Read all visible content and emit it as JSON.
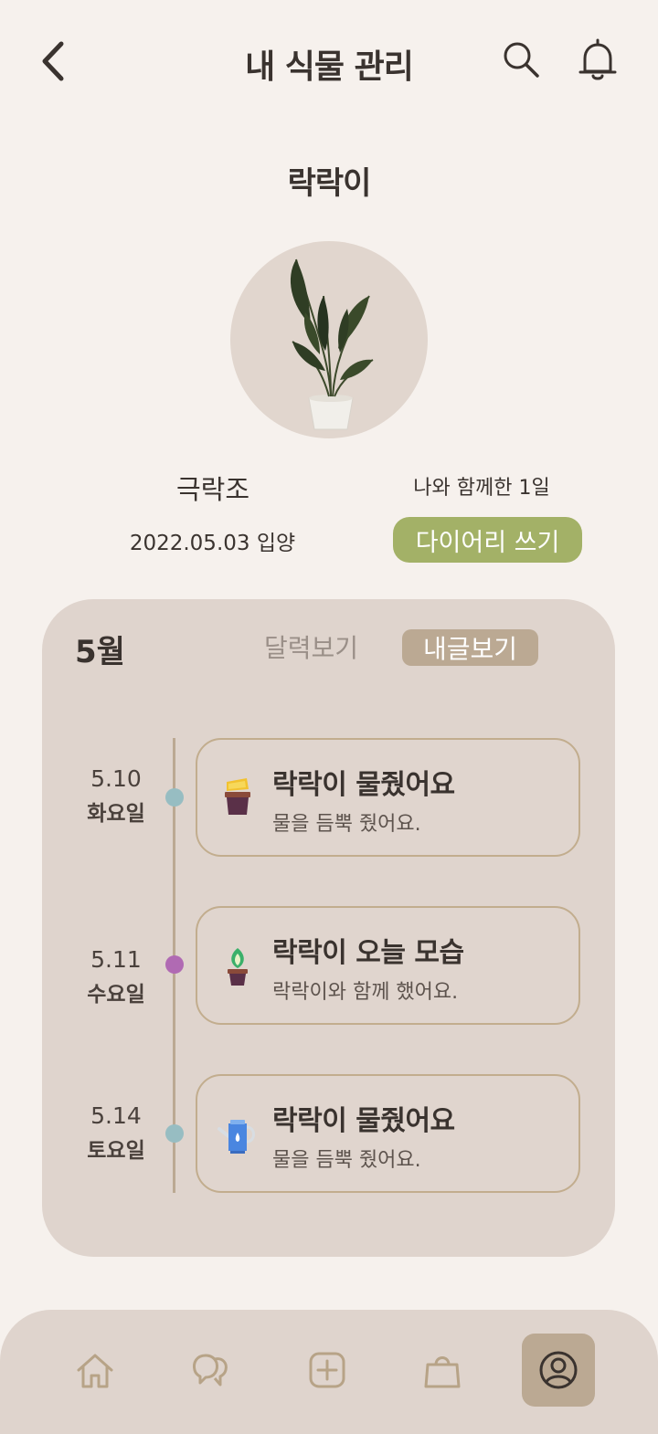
{
  "header": {
    "title": "내 식물 관리",
    "back_icon": "chevron-left-icon",
    "search_icon": "search-icon",
    "bell_icon": "bell-icon"
  },
  "plant": {
    "name": "락락이",
    "species": "극락조",
    "adopt_date": "2022.05.03 입양",
    "together": "나와 함께한 1일",
    "diary_button": "다이어리 쓰기"
  },
  "timeline_card": {
    "month": "5월",
    "tab_calendar": "달력보기",
    "tab_my_posts": "내글보기",
    "entries": [
      {
        "date": "5.10",
        "weekday": "화요일",
        "title": "락락이 물줬어요",
        "desc": "물을 듬뿍 줬어요.",
        "dot_color": "#97bdc2",
        "icon": "flower-pot-icon"
      },
      {
        "date": "5.11",
        "weekday": "수요일",
        "title": "락락이 오늘 모습",
        "desc": "락락이와 함께 했어요.",
        "dot_color": "#b06ab3",
        "icon": "sprout-icon"
      },
      {
        "date": "5.14",
        "weekday": "토요일",
        "title": "락락이 물줬어요",
        "desc": "물을 듬뿍 줬어요.",
        "dot_color": "#97bdc2",
        "icon": "watering-can-icon"
      }
    ]
  },
  "bottom_nav": {
    "items": [
      {
        "icon": "home-icon",
        "active": false
      },
      {
        "icon": "chat-icon",
        "active": false
      },
      {
        "icon": "add-icon",
        "active": false
      },
      {
        "icon": "shopping-bag-icon",
        "active": false
      },
      {
        "icon": "profile-icon",
        "active": true
      }
    ]
  },
  "colors": {
    "background": "#f6f1ed",
    "card": "#dfd4cd",
    "accent_green": "#a3b167",
    "accent_tan": "#bba993"
  }
}
